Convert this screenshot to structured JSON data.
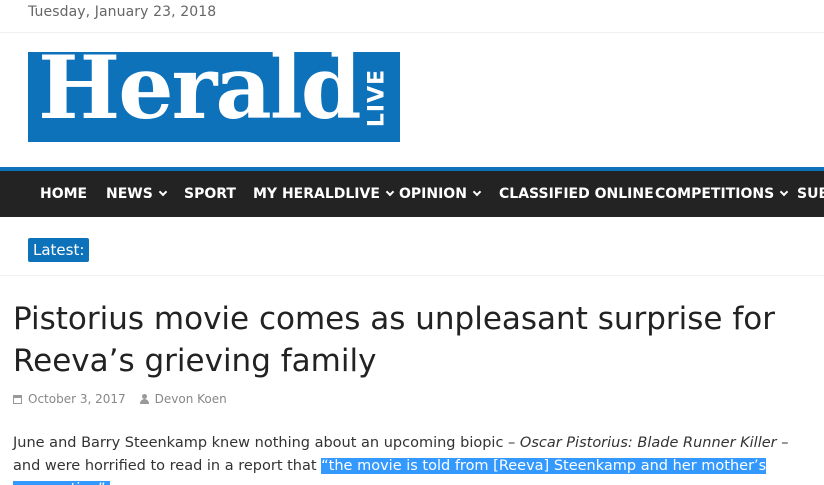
{
  "header": {
    "date": "Tuesday, January 23, 2018",
    "logo_word": "Herald",
    "logo_live": "LIVE"
  },
  "nav": {
    "items": [
      {
        "label": "HOME",
        "dropdown": false
      },
      {
        "label": "NEWS",
        "dropdown": true
      },
      {
        "label": "SPORT",
        "dropdown": false
      },
      {
        "label": "MY HERALDLIVE",
        "dropdown": true
      },
      {
        "label": "OPINION",
        "dropdown": true
      },
      {
        "label": "CLASSIFIED ONLINE",
        "dropdown": false
      },
      {
        "label": "COMPETITIONS",
        "dropdown": true
      },
      {
        "label": "SUB",
        "dropdown": false
      }
    ]
  },
  "latest": {
    "label": "Latest:"
  },
  "article": {
    "title": "Pistorius movie comes as unpleasant surprise for Reeva’s grieving family",
    "date": "October 3, 2017",
    "author": "Devon Koen",
    "body_part1": "June and Barry Steenkamp knew nothing about an upcoming biopic – ",
    "body_em": "Oscar Pistorius: Blade Runner Killer",
    "body_part2": " – and were horrified to read in a report that ",
    "body_highlight": "“the movie is told from [Reeva] Steenkamp and her mother’s perspective”",
    "body_end": "."
  },
  "colors": {
    "brand_blue": "#0e72bb",
    "nav_bg": "#232323",
    "selection": "#3399ff"
  }
}
